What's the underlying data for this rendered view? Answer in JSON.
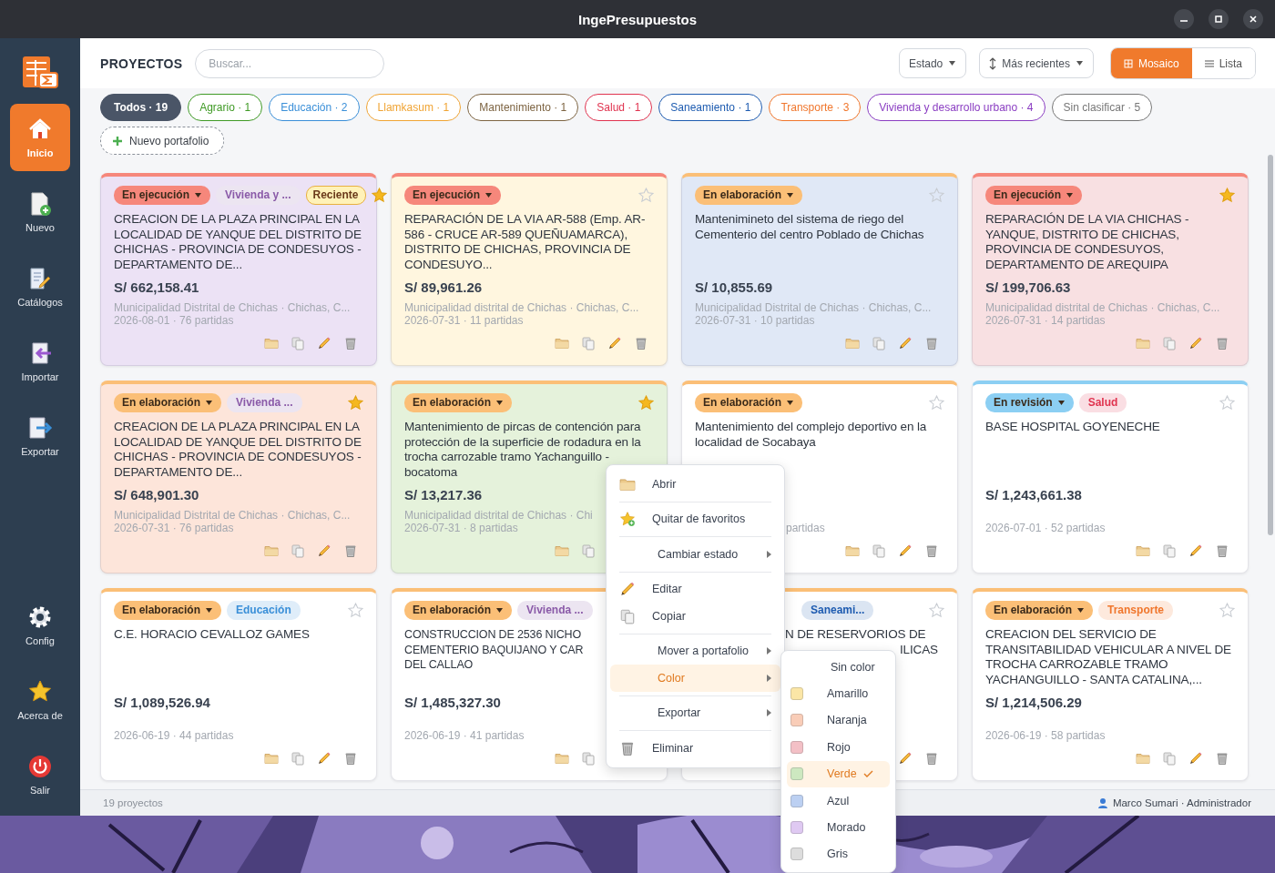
{
  "window": {
    "title": "IngePresupuestos"
  },
  "sidebar": {
    "items": [
      {
        "label": "Inicio",
        "kind": "home",
        "selected": true
      },
      {
        "label": "Nuevo",
        "kind": "new",
        "selected": false
      },
      {
        "label": "Catálogos",
        "kind": "catalog",
        "selected": false
      },
      {
        "label": "Importar",
        "kind": "import",
        "selected": false
      },
      {
        "label": "Exportar",
        "kind": "export",
        "selected": false
      },
      {
        "label": "Config",
        "kind": "gear",
        "selected": false
      },
      {
        "label": "Acerca de",
        "kind": "star",
        "selected": false
      },
      {
        "label": "Salir",
        "kind": "power",
        "selected": false
      }
    ]
  },
  "header": {
    "title": "PROYECTOS",
    "search": {
      "placeholder": "Buscar..."
    },
    "state_filter": {
      "label": "Estado"
    },
    "sort": {
      "label": "Más recientes"
    },
    "views": [
      {
        "label": "Mosaico",
        "kind": "grid",
        "selected": true
      },
      {
        "label": "Lista",
        "kind": "list",
        "selected": false
      }
    ]
  },
  "portfolios": [
    {
      "label": "Todos · 19",
      "color": "#4a5567",
      "selected": true
    },
    {
      "label": "Agrario · 1",
      "color": "#3f9a25",
      "selected": false
    },
    {
      "label": "Educación · 2",
      "color": "#3a8fd8",
      "selected": false
    },
    {
      "label": "Llamkasum · 1",
      "color": "#f0a434",
      "selected": false
    },
    {
      "label": "Mantenimiento · 1",
      "color": "#7d6442",
      "selected": false
    },
    {
      "label": "Salud · 1",
      "color": "#e0334f",
      "selected": false
    },
    {
      "label": "Saneamiento · 1",
      "color": "#1d5bb0",
      "selected": false
    },
    {
      "label": "Transporte · 3",
      "color": "#f0762c",
      "selected": false
    },
    {
      "label": "Vivienda y desarrollo urbano · 4",
      "color": "#8a3dc2",
      "selected": false
    },
    {
      "label": "Sin clasificar · 5",
      "color": "#777777",
      "selected": false
    }
  ],
  "new_portfolio": {
    "label": "Nuevo portafolio"
  },
  "projects": [
    {
      "color": "#ece2f5",
      "status": {
        "label": "En ejecución",
        "color": "#f6877b"
      },
      "tags": [
        {
          "label": "Vivienda y ...",
          "kind": "category",
          "color": "#8a5aa8"
        },
        {
          "label": "Reciente",
          "kind": "recent",
          "color": "#e8b040"
        }
      ],
      "favorite": true,
      "title": "CREACION DE LA PLAZA PRINCIPAL EN LA LOCALIDAD DE YANQUE DEL DISTRITO DE CHICHAS - PROVINCIA DE CONDESUYOS - DEPARTAMENTO DE...",
      "price": "S/ 662,158.41",
      "details": "Municipalidad Distrital de Chichas · Chichas, C...",
      "summary": "2026-08-01 · 76 partidas",
      "actions": [
        {
          "kind": "open"
        },
        {
          "kind": "copy"
        },
        {
          "kind": "edit"
        },
        {
          "kind": "delete"
        }
      ]
    },
    {
      "color": "#fff6df",
      "status": {
        "label": "En ejecución",
        "color": "#f6877b"
      },
      "favorite": false,
      "title": "REPARACIÓN DE LA VIA AR-588 (Emp. AR-586 - CRUCE AR-589 QUEÑUAMARCA), DISTRITO DE CHICHAS, PROVINCIA DE CONDESUYO...",
      "price": "S/ 89,961.26",
      "details": "Municipalidad distrital de Chichas · Chichas, C...",
      "summary": "2026-07-31 · 11 partidas",
      "actions": [
        {
          "kind": "open"
        },
        {
          "kind": "copy"
        },
        {
          "kind": "edit"
        },
        {
          "kind": "delete"
        }
      ]
    },
    {
      "color": "#e0e8f6",
      "status": {
        "label": "En elaboración",
        "color": "#fbbf77"
      },
      "favorite": false,
      "title": "Mantenimineto del sistema de riego del Cementerio del centro Poblado de Chichas",
      "price": "S/ 10,855.69",
      "details": "Municipalidad Distrital de Chichas · Chichas, C...",
      "summary": "2026-07-31 · 10 partidas",
      "actions": [
        {
          "kind": "open"
        },
        {
          "kind": "copy"
        },
        {
          "kind": "edit"
        },
        {
          "kind": "delete"
        }
      ]
    },
    {
      "color": "#f8e0e2",
      "status": {
        "label": "En ejecución",
        "color": "#f6877b"
      },
      "favorite": true,
      "title": "REPARACIÓN DE LA VIA CHICHAS - YANQUE, DISTRITO DE CHICHAS, PROVINCIA DE CONDESUYOS, DEPARTAMENTO DE AREQUIPA",
      "price": "S/ 199,706.63",
      "details": "Municipalidad distrital de Chichas · Chichas, C...",
      "summary": "2026-07-31 · 14 partidas",
      "actions": [
        {
          "kind": "open"
        },
        {
          "kind": "copy"
        },
        {
          "kind": "edit"
        },
        {
          "kind": "delete"
        }
      ]
    },
    {
      "color": "#fde5da",
      "status": {
        "label": "En elaboración",
        "color": "#fbbf77"
      },
      "tags": [
        {
          "label": "Vivienda ...",
          "kind": "category",
          "color": "#8a5aa8"
        }
      ],
      "favorite": true,
      "title": "CREACION DE LA PLAZA PRINCIPAL EN LA LOCALIDAD DE YANQUE DEL DISTRITO DE CHICHAS - PROVINCIA DE CONDESUYOS - DEPARTAMENTO DE...",
      "price": "S/ 648,901.30",
      "details": "Municipalidad Distrital de Chichas · Chichas, C...",
      "summary": "2026-07-31 · 76 partidas",
      "actions": [
        {
          "kind": "open"
        },
        {
          "kind": "copy"
        },
        {
          "kind": "edit"
        },
        {
          "kind": "delete"
        }
      ]
    },
    {
      "color": "#e5f2db",
      "status": {
        "label": "En elaboración",
        "color": "#fbbf77"
      },
      "favorite": true,
      "title": "Mantenimiento de pircas de contención para protección de la superficie de rodadura en la trocha carrozable tramo Yachanguillo - bocatoma",
      "price": "S/ 13,217.36",
      "details": "Municipalidad distrital de Chichas · Chi",
      "summary": "2026-07-31 · 8 partidas",
      "actions": [
        {
          "kind": "open"
        },
        {
          "kind": "copy"
        }
      ]
    },
    {
      "color": "#ffffff",
      "status": {
        "label": "En elaboración",
        "color": "#fbbf77"
      },
      "favorite": false,
      "title": "Mantenimiento del complejo deportivo en la localidad de Socabaya",
      "summary": "partidas",
      "actions": [
        {
          "kind": "open"
        },
        {
          "kind": "copy"
        },
        {
          "kind": "edit"
        },
        {
          "kind": "delete"
        }
      ]
    },
    {
      "color": "#ffffff",
      "status": {
        "label": "En revisión",
        "color": "#8ccff3"
      },
      "tags": [
        {
          "label": "Salud",
          "kind": "category",
          "color": "#e0334f"
        }
      ],
      "favorite": false,
      "title": "BASE HOSPITAL GOYENECHE",
      "price": "S/ 1,243,661.38",
      "summary": "2026-07-01 · 52 partidas",
      "actions": [
        {
          "kind": "open"
        },
        {
          "kind": "copy"
        },
        {
          "kind": "edit"
        },
        {
          "kind": "delete"
        }
      ]
    },
    {
      "color": "#ffffff",
      "status": {
        "label": "En elaboración",
        "color": "#fbbf77"
      },
      "tags": [
        {
          "label": "Educación",
          "kind": "category",
          "color": "#3a8fd8"
        }
      ],
      "favorite": false,
      "title": "C.E. HORACIO CEVALLOZ GAMES",
      "price": "S/ 1,089,526.94",
      "summary": "2026-06-19 · 44 partidas",
      "actions": [
        {
          "kind": "open"
        },
        {
          "kind": "copy"
        },
        {
          "kind": "edit"
        },
        {
          "kind": "delete"
        }
      ]
    },
    {
      "color": "#ffffff",
      "status": {
        "label": "En elaboración",
        "color": "#fbbf77"
      },
      "tags": [
        {
          "label": "Vivienda ...",
          "kind": "category",
          "color": "#8a5aa8"
        }
      ],
      "title": "CONSTRUCCION DE 2536 NICHO\nCEMENTERIO BAQUIJANO Y CAR\nDEL CALLAO",
      "price": "S/ 1,485,327.30",
      "summary": "2026-06-19 · 41 partidas",
      "actions": [
        {
          "kind": "open"
        },
        {
          "kind": "copy"
        }
      ]
    },
    {
      "color": "#ffffff",
      "status": {
        "color": "#fbbf77"
      },
      "tags": [
        {
          "label": "Saneami...",
          "kind": "category",
          "color": "#1d5bb0"
        }
      ],
      "favorite": false,
      "title": "N DE RESERVORIOS DE\nILICAS",
      "actions": [
        {
          "kind": "edit"
        },
        {
          "kind": "delete"
        }
      ]
    },
    {
      "color": "#ffffff",
      "status": {
        "label": "En elaboración",
        "color": "#fbbf77"
      },
      "tags": [
        {
          "label": "Transporte",
          "kind": "category",
          "color": "#f0762c"
        }
      ],
      "favorite": false,
      "title": "CREACION DEL SERVICIO DE TRANSITABILIDAD VEHICULAR A NIVEL DE TROCHA CARROZABLE TRAMO YACHANGUILLO - SANTA CATALINA,...",
      "price": "S/ 1,214,506.29",
      "summary": "2026-06-19 · 58 partidas",
      "actions": [
        {
          "kind": "open"
        },
        {
          "kind": "copy"
        },
        {
          "kind": "edit"
        },
        {
          "kind": "delete"
        }
      ]
    }
  ],
  "context_menu": {
    "items": [
      {
        "kind": "open",
        "label": "Abrir",
        "selected": false
      },
      {
        "kind": "separator"
      },
      {
        "kind": "unfavorite",
        "label": "Quitar de favoritos",
        "selected": false
      },
      {
        "kind": "separator"
      },
      {
        "kind": "submenu",
        "label": "Cambiar estado",
        "selected": false
      },
      {
        "kind": "separator"
      },
      {
        "kind": "edit",
        "label": "Editar",
        "selected": false
      },
      {
        "kind": "copy",
        "label": "Copiar",
        "selected": false
      },
      {
        "kind": "separator"
      },
      {
        "kind": "submenu",
        "label": "Mover a portafolio",
        "selected": false
      },
      {
        "kind": "submenu",
        "label": "Color",
        "selected": true
      },
      {
        "kind": "separator"
      },
      {
        "kind": "submenu",
        "label": "Exportar",
        "selected": false
      },
      {
        "kind": "separator"
      },
      {
        "kind": "delete",
        "label": "Eliminar",
        "selected": false
      }
    ]
  },
  "color_menu": {
    "items": [
      {
        "label": "Sin color",
        "selected": false
      },
      {
        "label": "Amarillo",
        "color": "#fbe6a6",
        "selected": false
      },
      {
        "label": "Naranja",
        "color": "#f9cdb8",
        "selected": false
      },
      {
        "label": "Rojo",
        "color": "#f3c0c6",
        "selected": false
      },
      {
        "label": "Verde",
        "color": "#cde8c0",
        "selected": true
      },
      {
        "label": "Azul",
        "color": "#bcd0f2",
        "selected": false
      },
      {
        "label": "Morado",
        "color": "#dfc9f2",
        "selected": false
      },
      {
        "label": "Gris",
        "color": "#dddddd",
        "selected": false
      }
    ]
  },
  "status_bar": {
    "count": "19 proyectos",
    "user": "Marco Sumari · Administrador"
  }
}
